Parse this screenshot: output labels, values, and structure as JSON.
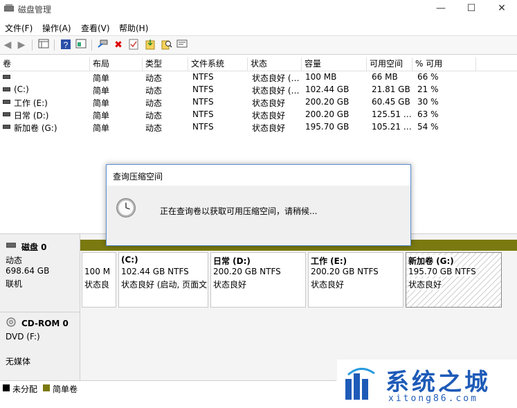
{
  "window": {
    "title": "磁盘管理",
    "minimize": "—",
    "maximize": "☐",
    "close": "✕"
  },
  "menu": [
    "文件(F)",
    "操作(A)",
    "查看(V)",
    "帮助(H)"
  ],
  "toolbar_icons": [
    "back-icon",
    "forward-icon",
    "list-view-icon",
    "help-icon",
    "properties-icon",
    "connect-icon",
    "delete-icon",
    "check-icon",
    "import-icon",
    "search-icon",
    "settings-icon"
  ],
  "volume_table": {
    "headers": [
      "卷",
      "布局",
      "类型",
      "文件系统",
      "状态",
      "容量",
      "可用空间",
      "% 可用"
    ],
    "rows": [
      [
        "",
        "简单",
        "动态",
        "NTFS",
        "状态良好 (…",
        "100 MB",
        "66 MB",
        "66 %"
      ],
      [
        "(C:)",
        "简单",
        "动态",
        "NTFS",
        "状态良好 (…",
        "102.44 GB",
        "21.81 GB",
        "21 %"
      ],
      [
        "工作 (E:)",
        "简单",
        "动态",
        "NTFS",
        "状态良好",
        "200.20 GB",
        "60.45 GB",
        "30 %"
      ],
      [
        "日常 (D:)",
        "简单",
        "动态",
        "NTFS",
        "状态良好",
        "200.20 GB",
        "125.51 …",
        "63 %"
      ],
      [
        "新加卷 (G:)",
        "简单",
        "动态",
        "NTFS",
        "状态良好",
        "195.70 GB",
        "105.21 …",
        "54 %"
      ]
    ]
  },
  "dialog": {
    "title": "查询压缩空间",
    "message": "正在查询卷以获取可用压缩空间，请稍候..."
  },
  "disk0": {
    "name": "磁盘 0",
    "type": "动态",
    "size": "698.64 GB",
    "status": "联机",
    "partitions": [
      {
        "name": "",
        "line1": "100 M",
        "line2": "状态良"
      },
      {
        "name": "(C:)",
        "line1": "102.44 GB NTFS",
        "line2": "状态良好 (启动, 页面文"
      },
      {
        "name": "日常  (D:)",
        "line1": "200.20 GB NTFS",
        "line2": "状态良好"
      },
      {
        "name": "工作  (E:)",
        "line1": "200.20 GB NTFS",
        "line2": "状态良好"
      },
      {
        "name": "新加卷  (G:)",
        "line1": "195.70 GB NTFS",
        "line2": "状态良好"
      }
    ]
  },
  "cdrom0": {
    "name": "CD-ROM 0",
    "drive": "DVD (F:)",
    "media": "无媒体"
  },
  "legend": [
    {
      "label": "未分配",
      "color": "#000000"
    },
    {
      "label": "简单卷",
      "color": "#7a7a10"
    }
  ],
  "watermark": {
    "text": "系统之城",
    "url": "xitong86.com"
  }
}
